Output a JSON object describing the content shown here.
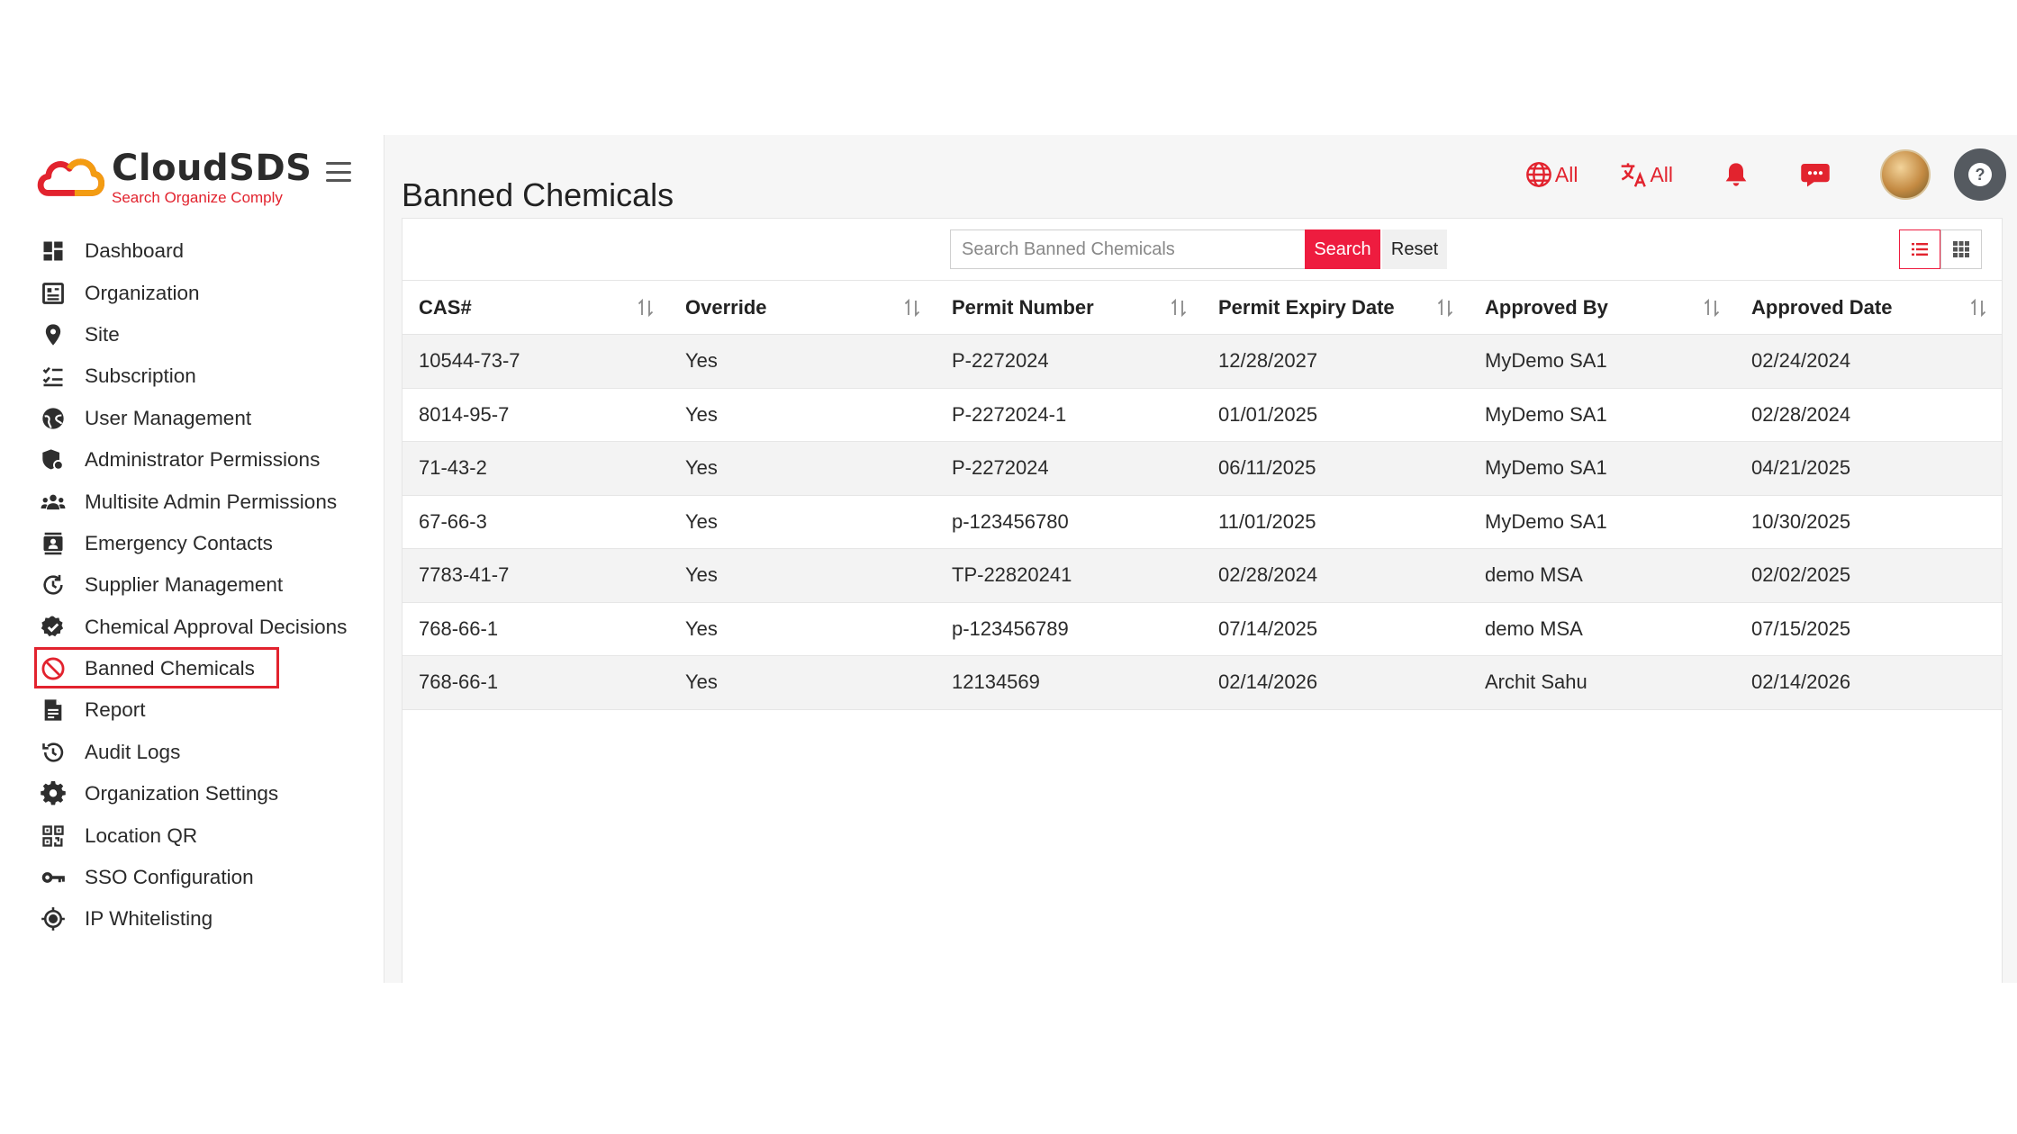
{
  "brand": {
    "name": "CloudSDS",
    "tagline": "Search Organize  Comply",
    "colors": {
      "red": "#e2232e",
      "orange": "#f39c12",
      "dark": "#2b2b2b"
    }
  },
  "sidebar": {
    "items": [
      {
        "label": "Dashboard",
        "icon": "dashboard-icon"
      },
      {
        "label": "Organization",
        "icon": "building-icon"
      },
      {
        "label": "Site",
        "icon": "map-pin-icon"
      },
      {
        "label": "Subscription",
        "icon": "checklist-icon"
      },
      {
        "label": "User Management",
        "icon": "globe-user-icon"
      },
      {
        "label": "Administrator Permissions",
        "icon": "admin-shield-icon"
      },
      {
        "label": "Multisite Admin Permissions",
        "icon": "users-group-icon"
      },
      {
        "label": "Emergency Contacts",
        "icon": "contact-card-icon"
      },
      {
        "label": "Supplier Management",
        "icon": "refresh-clock-icon"
      },
      {
        "label": "Chemical Approval Decisions",
        "icon": "badge-check-icon"
      },
      {
        "label": "Banned Chemicals",
        "icon": "ban-icon",
        "active": true
      },
      {
        "label": "Report",
        "icon": "report-icon"
      },
      {
        "label": "Audit Logs",
        "icon": "history-icon"
      },
      {
        "label": "Organization Settings",
        "icon": "gear-icon"
      },
      {
        "label": "Location QR",
        "icon": "qr-code-icon"
      },
      {
        "label": "SSO Configuration",
        "icon": "key-icon"
      },
      {
        "label": "IP Whitelisting",
        "icon": "crosshair-icon"
      }
    ]
  },
  "header": {
    "title": "Banned Chemicals",
    "region_label": "All",
    "language_label": "All",
    "accent": "#e2232e"
  },
  "search": {
    "placeholder": "Search Banned Chemicals",
    "value": "",
    "search_label": "Search",
    "reset_label": "Reset"
  },
  "table": {
    "columns": [
      "CAS#",
      "Override",
      "Permit Number",
      "Permit Expiry Date",
      "Approved By",
      "Approved Date"
    ],
    "rows": [
      [
        "10544-73-7",
        "Yes",
        "P-2272024",
        "12/28/2027",
        "MyDemo SA1",
        "02/24/2024"
      ],
      [
        "8014-95-7",
        "Yes",
        "P-2272024-1",
        "01/01/2025",
        "MyDemo SA1",
        "02/28/2024"
      ],
      [
        "71-43-2",
        "Yes",
        "P-2272024",
        "06/11/2025",
        "MyDemo SA1",
        "04/21/2025"
      ],
      [
        "67-66-3",
        "Yes",
        "p-123456780",
        "11/01/2025",
        "MyDemo SA1",
        "10/30/2025"
      ],
      [
        "7783-41-7",
        "Yes",
        "TP-22820241",
        "02/28/2024",
        "demo MSA",
        "02/02/2025"
      ],
      [
        "768-66-1",
        "Yes",
        "p-123456789",
        "07/14/2025",
        "demo MSA",
        "07/15/2025"
      ],
      [
        "768-66-1",
        "Yes",
        "12134569",
        "02/14/2026",
        "Archit Sahu",
        "02/14/2026"
      ]
    ]
  }
}
